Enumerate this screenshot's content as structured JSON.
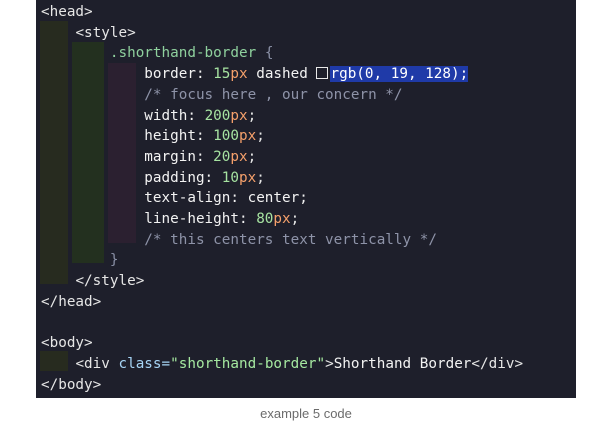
{
  "code": {
    "l1": "<head>",
    "l2": "<style>",
    "l3_sel": ".shorthand-border",
    "l3_brace": "{",
    "l4_prop": "border: ",
    "l4_num": "15",
    "l4_unit": "px",
    "l4_mid": " dashed ",
    "l4_color": "rgb(0, 19, 128)",
    "l4_end": ";",
    "l5": "/* focus here , our concern */",
    "l6_prop": "width: ",
    "l6_num": "200",
    "l6_unit": "px",
    "l7_prop": "height: ",
    "l7_num": "100",
    "l7_unit": "px",
    "l8_prop": "margin: ",
    "l8_num": "20",
    "l8_unit": "px",
    "l9_prop": "padding: ",
    "l9_num": "10",
    "l9_unit": "px",
    "l10": "text-align: center;",
    "l11_prop": "line-height: ",
    "l11_num": "80",
    "l11_unit": "px",
    "l12": "/* this centers text vertically */",
    "l13": "}",
    "l14": "</style>",
    "l15": "</head>",
    "l17": "<body>",
    "l18_open": "<div ",
    "l18_attr": "class=",
    "l18_str": "\"shorthand-border\"",
    "l18_gt": ">",
    "l18_text": "Shorthand Border",
    "l18_close": "</div>",
    "l19": "</body>",
    "semi": ";"
  },
  "caption": "example 5 code",
  "colors": {
    "background": "#1e1f2b",
    "selection": "#1f3aa8"
  }
}
